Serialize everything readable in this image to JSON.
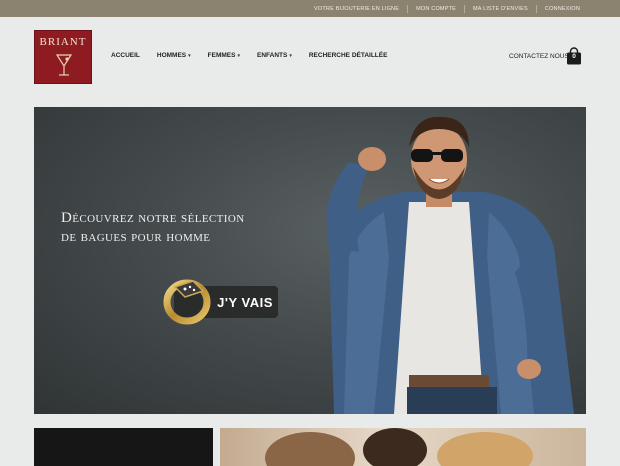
{
  "topbar": {
    "links": [
      "VOTRE BIJOUTERIE EN LIGNE",
      "MON COMPTE",
      "MA LISTE D'ENVIES",
      "CONNEXION"
    ]
  },
  "logo": {
    "text": "BRIANT"
  },
  "nav": {
    "items": [
      {
        "label": "ACCUEIL",
        "has_dropdown": false
      },
      {
        "label": "HOMMES",
        "has_dropdown": true
      },
      {
        "label": "FEMMES",
        "has_dropdown": true
      },
      {
        "label": "ENFANTS",
        "has_dropdown": true
      },
      {
        "label": "RECHERCHE DÉTAILLÉE",
        "has_dropdown": false
      }
    ]
  },
  "header": {
    "contact_label": "CONTACTEZ NOUS",
    "cart_count": "0"
  },
  "hero": {
    "title_line1": "Découvrez notre sélection",
    "title_line2": "de bagues pour homme",
    "cta_label": "J'Y VAIS"
  },
  "colors": {
    "topbar": "#8c8270",
    "brand_red": "#8e1a22",
    "page_bg": "#e9ebea",
    "button_dark": "#2a2b2b"
  },
  "icons": [
    "chevron-down-icon",
    "shopping-bag-icon",
    "ring-image",
    "logo-glass-icon"
  ]
}
